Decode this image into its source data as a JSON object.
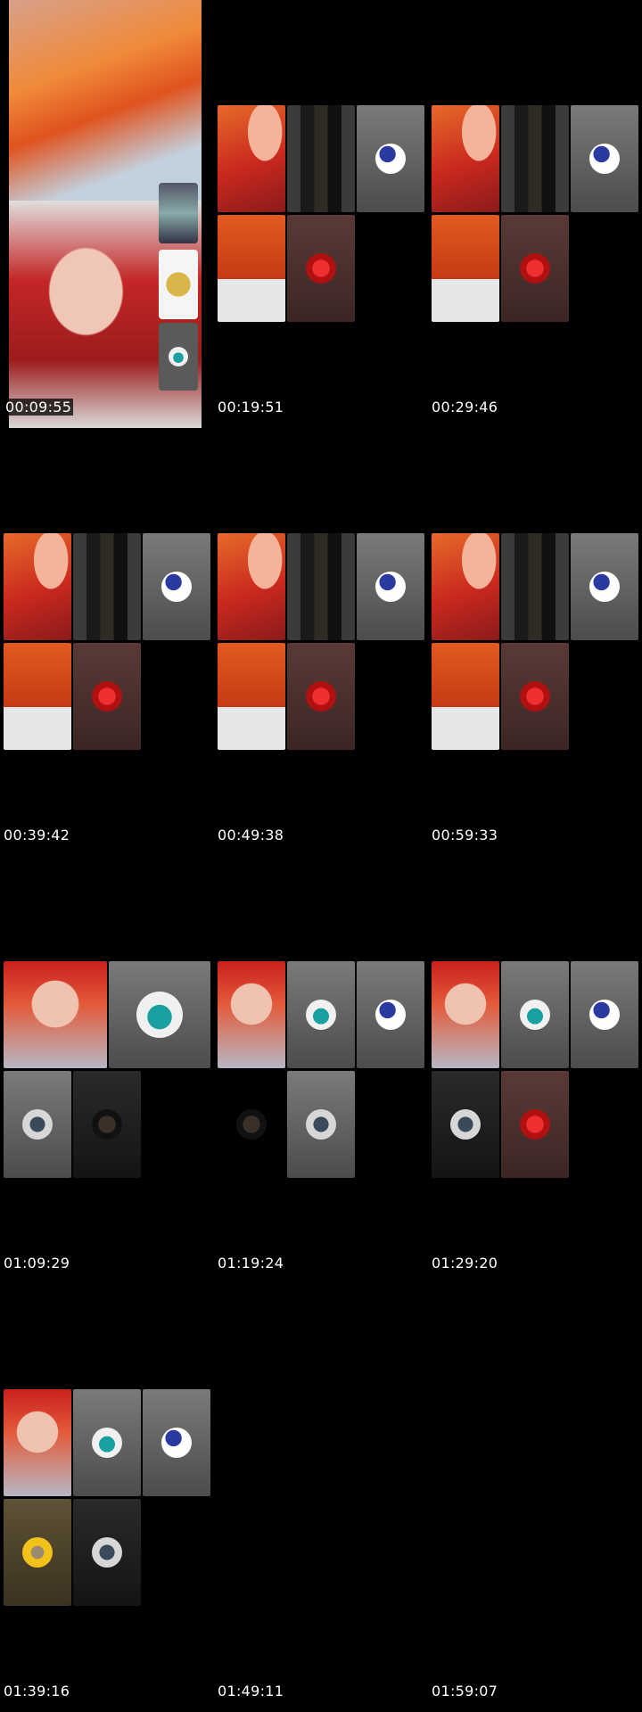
{
  "thumbnails": [
    {
      "timestamp": "00:09:55"
    },
    {
      "timestamp": "00:19:51"
    },
    {
      "timestamp": "00:29:46"
    },
    {
      "timestamp": "00:39:42"
    },
    {
      "timestamp": "00:49:38"
    },
    {
      "timestamp": "00:59:33"
    },
    {
      "timestamp": "01:09:29"
    },
    {
      "timestamp": "01:19:24"
    },
    {
      "timestamp": "01:29:20"
    },
    {
      "timestamp": "01:39:16"
    },
    {
      "timestamp": "01:49:11"
    },
    {
      "timestamp": "01:59:07"
    }
  ],
  "colors": {
    "background": "#000000",
    "timestamp_text": "#ffffff"
  }
}
